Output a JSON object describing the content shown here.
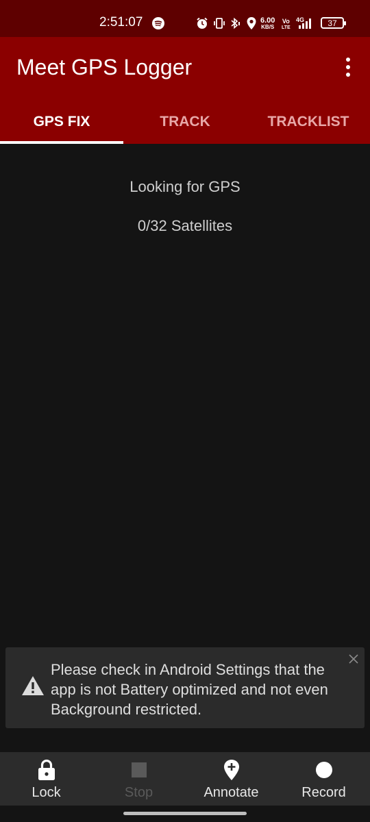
{
  "status_bar": {
    "time": "2:51:07",
    "net_speed_value": "6.00",
    "net_speed_unit": "KB/S",
    "volte_top": "Vo",
    "volte_bottom": "LTE",
    "network": "4G",
    "battery": "37"
  },
  "app_bar": {
    "title": "Meet GPS Logger"
  },
  "tabs": [
    {
      "label": "GPS FIX",
      "active": true
    },
    {
      "label": "TRACK",
      "active": false
    },
    {
      "label": "TRACKLIST",
      "active": false
    }
  ],
  "gps_fix": {
    "status": "Looking for GPS",
    "satellites": "0/32 Satellites"
  },
  "snackbar": {
    "message": "Please check in Android Settings that the app is not Battery optimized and not even Background restricted."
  },
  "toolbar": {
    "lock_label": "Lock",
    "stop_label": "Stop",
    "annotate_label": "Annotate",
    "record_label": "Record"
  },
  "colors": {
    "status_bar": "#5e0000",
    "app_bar": "#8b0000",
    "background": "#141414",
    "toolbar": "#2c2c2c"
  }
}
